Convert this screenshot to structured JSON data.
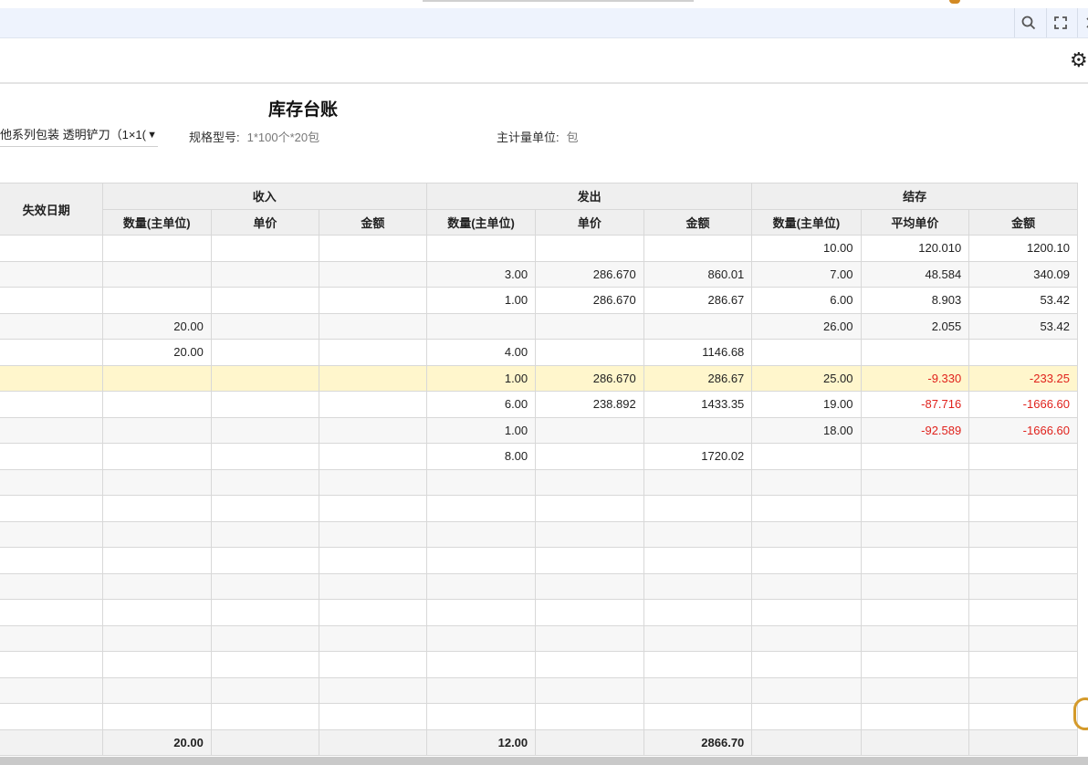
{
  "toolbar": {
    "icons": [
      "search-icon",
      "fullscreen-icon",
      "close-icon"
    ]
  },
  "page": {
    "title": "库存台账",
    "material_select": "他系列包装 透明铲刀（1×1(",
    "spec_label": "规格型号:",
    "spec_value": "1*100个*20包",
    "unit_label": "主计量单位:",
    "unit_value": "包"
  },
  "table": {
    "headers": {
      "expiry": "失效日期",
      "income": "收入",
      "outgo": "发出",
      "balance": "结存",
      "qty": "数量(主单位)",
      "unit_price": "单价",
      "amount": "金额",
      "avg_price": "平均单价"
    },
    "rows": [
      {
        "in_qty": "",
        "in_price": "",
        "in_amount": "",
        "out_qty": "",
        "out_price": "",
        "out_amount": "",
        "bal_qty": "10.00",
        "bal_price": "120.010",
        "bal_amount": "1200.10"
      },
      {
        "in_qty": "",
        "in_price": "",
        "in_amount": "",
        "out_qty": "3.00",
        "out_price": "286.670",
        "out_amount": "860.01",
        "bal_qty": "7.00",
        "bal_price": "48.584",
        "bal_amount": "340.09"
      },
      {
        "in_qty": "",
        "in_price": "",
        "in_amount": "",
        "out_qty": "1.00",
        "out_price": "286.670",
        "out_amount": "286.67",
        "bal_qty": "6.00",
        "bal_price": "8.903",
        "bal_amount": "53.42"
      },
      {
        "in_qty": "20.00",
        "in_price": "",
        "in_amount": "",
        "out_qty": "",
        "out_price": "",
        "out_amount": "",
        "bal_qty": "26.00",
        "bal_price": "2.055",
        "bal_amount": "53.42"
      },
      {
        "in_qty": "20.00",
        "in_price": "",
        "in_amount": "",
        "out_qty": "4.00",
        "out_price": "",
        "out_amount": "1146.68",
        "bal_qty": "",
        "bal_price": "",
        "bal_amount": ""
      },
      {
        "in_qty": "",
        "in_price": "",
        "in_amount": "",
        "out_qty": "1.00",
        "out_price": "286.670",
        "out_amount": "286.67",
        "bal_qty": "25.00",
        "bal_price": "-9.330",
        "bal_amount": "-233.25"
      },
      {
        "in_qty": "",
        "in_price": "",
        "in_amount": "",
        "out_qty": "6.00",
        "out_price": "238.892",
        "out_amount": "1433.35",
        "bal_qty": "19.00",
        "bal_price": "-87.716",
        "bal_amount": "-1666.60"
      },
      {
        "in_qty": "",
        "in_price": "",
        "in_amount": "",
        "out_qty": "1.00",
        "out_price": "",
        "out_amount": "",
        "bal_qty": "18.00",
        "bal_price": "-92.589",
        "bal_amount": "-1666.60"
      },
      {
        "in_qty": "",
        "in_price": "",
        "in_amount": "",
        "out_qty": "8.00",
        "out_price": "",
        "out_amount": "1720.02",
        "bal_qty": "",
        "bal_price": "",
        "bal_amount": ""
      }
    ],
    "empty_rows": 10,
    "footer": {
      "in_qty": "20.00",
      "out_qty": "12.00",
      "out_amount": "2866.70"
    }
  },
  "colors": {
    "negative": "#e0221c",
    "highlight_row": "#fff6cc",
    "toolbar_bg": "#eef3fd"
  }
}
